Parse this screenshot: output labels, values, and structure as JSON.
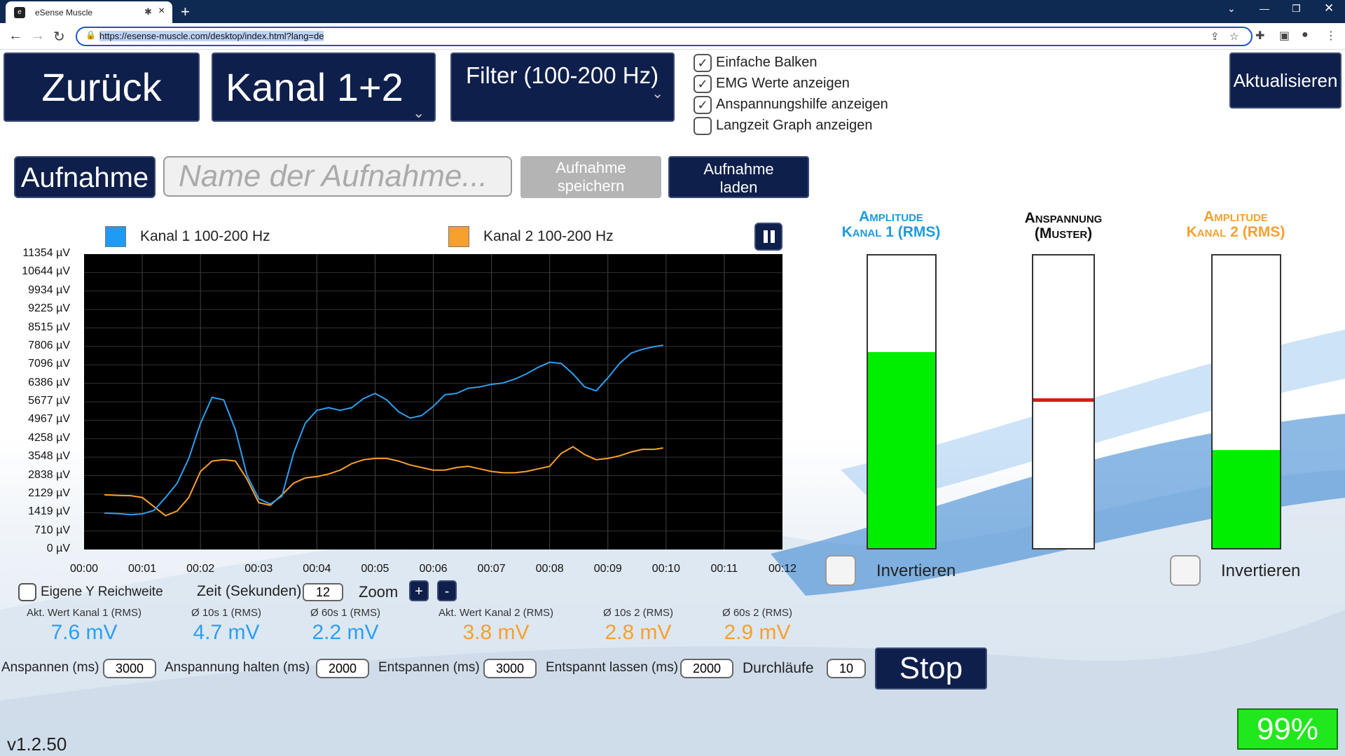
{
  "browser": {
    "tab_title": "eSense Muscle",
    "url": "https://esense-muscle.com/desktop/index.html?lang=de"
  },
  "header": {
    "back_label": "Zurück",
    "channel_select": "Kanal 1+2",
    "filter_select": "Filter (100-200 Hz)",
    "refresh_label": "Aktualisieren",
    "options": [
      {
        "label": "Einfache Balken",
        "checked": true
      },
      {
        "label": "EMG Werte anzeigen",
        "checked": true
      },
      {
        "label": "Anspannungshilfe anzeigen",
        "checked": true
      },
      {
        "label": "Langzeit Graph anzeigen",
        "checked": false
      }
    ]
  },
  "recording": {
    "record_label": "Aufnahme",
    "name_placeholder": "Name der Aufnahme...",
    "save_label_1": "Aufnahme",
    "save_label_2": "speichern",
    "load_label_1": "Aufnahme",
    "load_label_2": "laden"
  },
  "chart_data": {
    "type": "line",
    "legend": [
      "Kanal 1 100-200 Hz",
      "Kanal 2 100-200 Hz"
    ],
    "colors": {
      "kanal1": "#2c9ff0",
      "kanal2": "#f7a02e"
    },
    "y_ticks": [
      "11354 µV",
      "10644 µV",
      "9934 µV",
      "9225 µV",
      "8515 µV",
      "7806 µV",
      "7096 µV",
      "6386 µV",
      "5677 µV",
      "4967 µV",
      "4258 µV",
      "3548 µV",
      "2838 µV",
      "2129 µV",
      "1419 µV",
      "710 µV",
      "0 µV"
    ],
    "x_ticks": [
      "00:00",
      "00:01",
      "00:02",
      "00:03",
      "00:04",
      "00:05",
      "00:06",
      "00:07",
      "00:08",
      "00:09",
      "00:10",
      "00:11",
      "00:12"
    ],
    "ylim": [
      0,
      11354
    ],
    "xlim": [
      0,
      12
    ],
    "series": [
      {
        "name": "Kanal 1 100-200 Hz",
        "x": [
          0.35,
          0.6,
          0.8,
          1.0,
          1.2,
          1.4,
          1.6,
          1.8,
          2.0,
          2.2,
          2.4,
          2.6,
          2.8,
          3.0,
          3.2,
          3.4,
          3.6,
          3.8,
          4.0,
          4.2,
          4.4,
          4.6,
          4.8,
          5.0,
          5.2,
          5.4,
          5.6,
          5.8,
          6.0,
          6.2,
          6.4,
          6.6,
          6.8,
          7.0,
          7.2,
          7.4,
          7.6,
          7.8,
          8.0,
          8.2,
          8.4,
          8.6,
          8.8,
          9.0,
          9.2,
          9.4,
          9.6,
          9.8,
          9.95
        ],
        "values": [
          1400,
          1380,
          1340,
          1370,
          1500,
          2000,
          2550,
          3500,
          4850,
          5850,
          5750,
          4600,
          2850,
          1950,
          1750,
          2050,
          3700,
          4850,
          5350,
          5450,
          5350,
          5450,
          5800,
          6000,
          5750,
          5300,
          5050,
          5150,
          5500,
          5950,
          6000,
          6200,
          6250,
          6350,
          6400,
          6550,
          6750,
          7000,
          7200,
          7150,
          6750,
          6250,
          6100,
          6600,
          7150,
          7550,
          7700,
          7800,
          7850
        ]
      },
      {
        "name": "Kanal 2 100-200 Hz",
        "x": [
          0.35,
          0.6,
          0.8,
          1.0,
          1.2,
          1.4,
          1.6,
          1.8,
          2.0,
          2.2,
          2.4,
          2.6,
          2.8,
          3.0,
          3.2,
          3.4,
          3.6,
          3.8,
          4.0,
          4.2,
          4.4,
          4.6,
          4.8,
          5.0,
          5.2,
          5.4,
          5.6,
          5.8,
          6.0,
          6.2,
          6.4,
          6.6,
          6.8,
          7.0,
          7.2,
          7.4,
          7.6,
          7.8,
          8.0,
          8.2,
          8.4,
          8.6,
          8.8,
          9.0,
          9.2,
          9.4,
          9.6,
          9.8,
          9.95
        ],
        "values": [
          2100,
          2080,
          2070,
          2000,
          1650,
          1300,
          1480,
          2000,
          3000,
          3400,
          3450,
          3400,
          2700,
          1800,
          1700,
          2100,
          2550,
          2750,
          2800,
          2900,
          3050,
          3300,
          3450,
          3500,
          3500,
          3400,
          3250,
          3150,
          3050,
          3050,
          3150,
          3200,
          3100,
          3000,
          2950,
          2950,
          3000,
          3100,
          3200,
          3700,
          3950,
          3650,
          3450,
          3500,
          3600,
          3750,
          3850,
          3850,
          3900
        ]
      }
    ]
  },
  "chart_controls": {
    "own_y_range_label": "Eigene Y Reichweite",
    "time_label": "Zeit (Sekunden)",
    "time_value": "12",
    "zoom_label": "Zoom",
    "zoom_in": "+",
    "zoom_out": "-"
  },
  "stats": [
    {
      "label": "Akt. Wert Kanal 1 (RMS)",
      "value": "7.6 mV",
      "color": "#2c9ff0"
    },
    {
      "label": "Ø 10s 1 (RMS)",
      "value": "4.7 mV",
      "color": "#2c9ff0"
    },
    {
      "label": "Ø 60s 1 (RMS)",
      "value": "2.2 mV",
      "color": "#2c9ff0"
    },
    {
      "label": "Akt. Wert Kanal 2 (RMS)",
      "value": "3.8 mV",
      "color": "#f7a02e"
    },
    {
      "label": "Ø 10s 2 (RMS)",
      "value": "2.8 mV",
      "color": "#f7a02e"
    },
    {
      "label": "Ø 60s 2 (RMS)",
      "value": "2.9 mV",
      "color": "#f7a02e"
    }
  ],
  "tension_settings": {
    "tense_label": "Anspannen (ms)",
    "tense_value": "3000",
    "hold_label": "Anspannung halten (ms)",
    "hold_value": "2000",
    "relax_label": "Entspannen (ms)",
    "relax_value": "3000",
    "relaxed_label": "Entspannt lassen (ms)",
    "relaxed_value": "2000",
    "runs_label": "Durchläufe",
    "runs_value": "10",
    "stop_label": "Stop"
  },
  "meters": {
    "amp1_title_1": "Amplitude",
    "amp1_title_2": "Kanal 1 (RMS)",
    "amp1_level": 0.67,
    "amp1_color": "#1a9be0",
    "tension_title_1": "Anspannung",
    "tension_title_2": "(Muster)",
    "tension_level": 0.5,
    "amp2_title_1": "Amplitude",
    "amp2_title_2": "Kanal 2 (RMS)",
    "amp2_level": 0.335,
    "amp2_color": "#f7a02e",
    "invert_label_1": "Invertieren",
    "invert_label_2": "Invertieren"
  },
  "footer": {
    "version": "v1.2.50",
    "battery": "99%"
  }
}
